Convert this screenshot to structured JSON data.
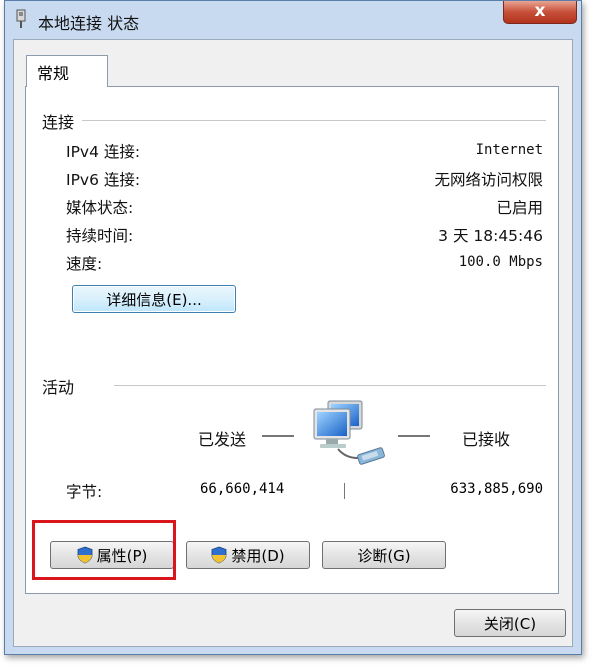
{
  "window": {
    "title": "本地连接 状态",
    "close_label": "x"
  },
  "tabs": [
    {
      "label": "常规"
    }
  ],
  "connection": {
    "group_label": "连接",
    "rows": [
      {
        "label": "IPv4 连接:",
        "value": "Internet"
      },
      {
        "label": "IPv6 连接:",
        "value": "无网络访问权限"
      },
      {
        "label": "媒体状态:",
        "value": "已启用"
      },
      {
        "label": "持续时间:",
        "value": "3 天 18:45:46"
      },
      {
        "label": "速度:",
        "value": "100.0 Mbps"
      }
    ],
    "details_button": "详细信息(E)..."
  },
  "activity": {
    "group_label": "活动",
    "sent_label": "已发送",
    "received_label": "已接收",
    "bytes_label": "字节:",
    "bytes_sent": "66,660,414",
    "bytes_received": "633,885,690",
    "icon": "network-computers-icon"
  },
  "actions": {
    "properties": "属性(P)",
    "disable": "禁用(D)",
    "diagnose": "诊断(G)"
  },
  "footer": {
    "close_button": "关闭(C)"
  },
  "colors": {
    "highlight": "#d9161c",
    "close_button": "#c7503a"
  }
}
